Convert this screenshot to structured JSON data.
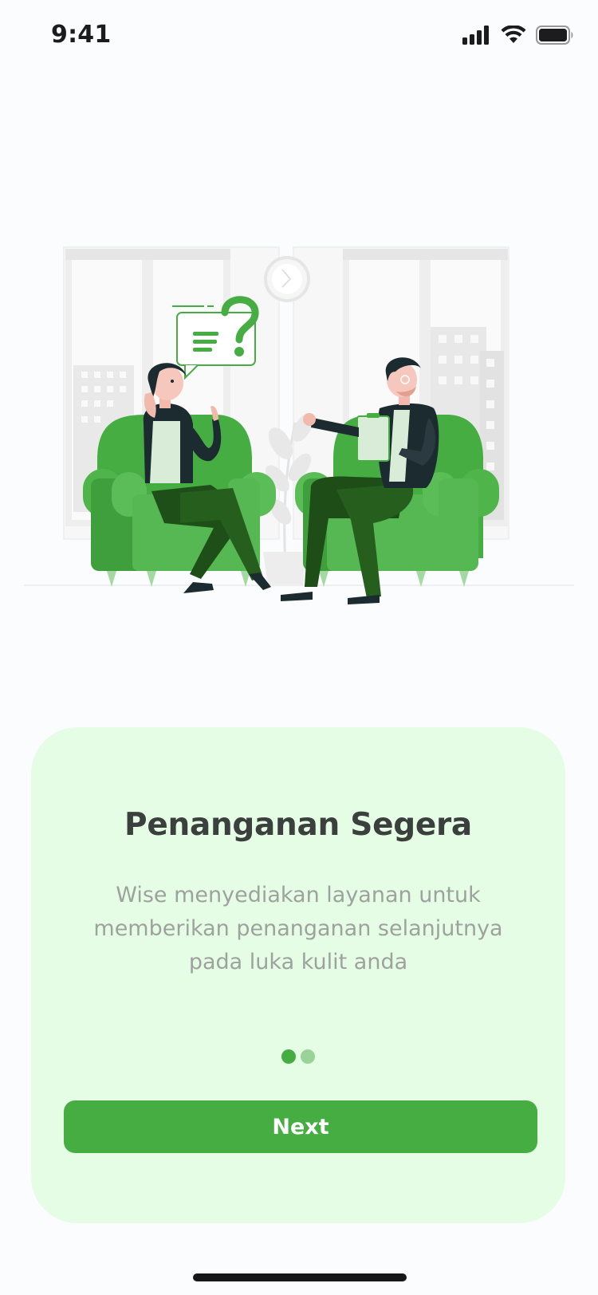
{
  "status_bar": {
    "time": "9:41"
  },
  "illustration": {
    "icons": [
      "clock-icon",
      "question-chat-icon",
      "checklist-icon"
    ]
  },
  "onboarding": {
    "title": "Penanganan Segera",
    "description": "Wise menyediakan layanan untuk\nmemberikan penanganan selanjutnya\npada luka kulit anda",
    "page_index": 1,
    "page_count": 2,
    "next_label": "Next"
  },
  "colors": {
    "accent": "#46ad43",
    "card_background": "#e5fde4",
    "title": "#3b3f3d",
    "description": "#9ea29f"
  }
}
